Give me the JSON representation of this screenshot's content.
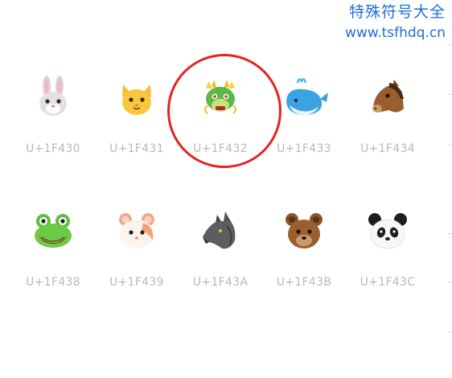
{
  "watermark": {
    "site_name": "特殊符号大全",
    "url": "www.tsfhdq.cn"
  },
  "highlight_color": "#e52421",
  "emoji_rows": [
    [
      {
        "code": "U+1F430",
        "icon": "rabbit-face-icon"
      },
      {
        "code": "U+1F431",
        "icon": "cat-face-icon"
      },
      {
        "code": "U+1F432",
        "icon": "dragon-face-icon",
        "highlighted": true
      },
      {
        "code": "U+1F433",
        "icon": "spouting-whale-icon"
      },
      {
        "code": "U+1F434",
        "icon": "horse-face-icon"
      }
    ],
    [
      {
        "code": "U+1F438",
        "icon": "frog-face-icon"
      },
      {
        "code": "U+1F439",
        "icon": "hamster-face-icon"
      },
      {
        "code": "U+1F43A",
        "icon": "wolf-face-icon"
      },
      {
        "code": "U+1F43B",
        "icon": "bear-face-icon"
      },
      {
        "code": "U+1F43C",
        "icon": "panda-face-icon"
      }
    ]
  ]
}
